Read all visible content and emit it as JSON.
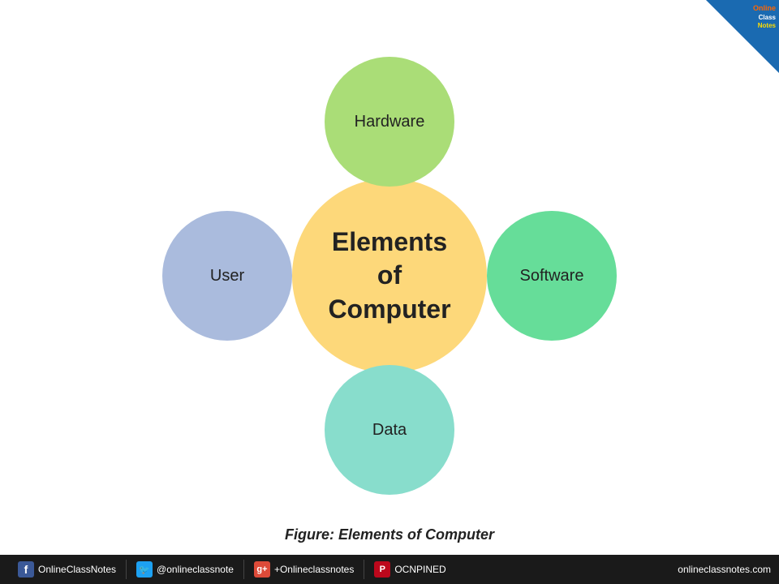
{
  "diagram": {
    "center_label": "Elements\nof\nComputer",
    "center_line1": "Elements",
    "center_line2": "of",
    "center_line3": "Computer",
    "hardware_label": "Hardware",
    "software_label": "Software",
    "data_label": "Data",
    "user_label": "User",
    "caption": "Figure: Elements of Computer"
  },
  "footer": {
    "fb_icon": "f",
    "fb_text": "OnlineClassNotes",
    "tw_icon": "🐦",
    "tw_text": "@onlineclassnote",
    "gp_icon": "g+",
    "gp_text": "+Onlineclassnotes",
    "pi_icon": "P",
    "pi_text": "OCNPINED",
    "website": "onlineclassnotes.com"
  },
  "badge": {
    "line1": "Online",
    "line2": "Class",
    "line3": "Notes"
  }
}
